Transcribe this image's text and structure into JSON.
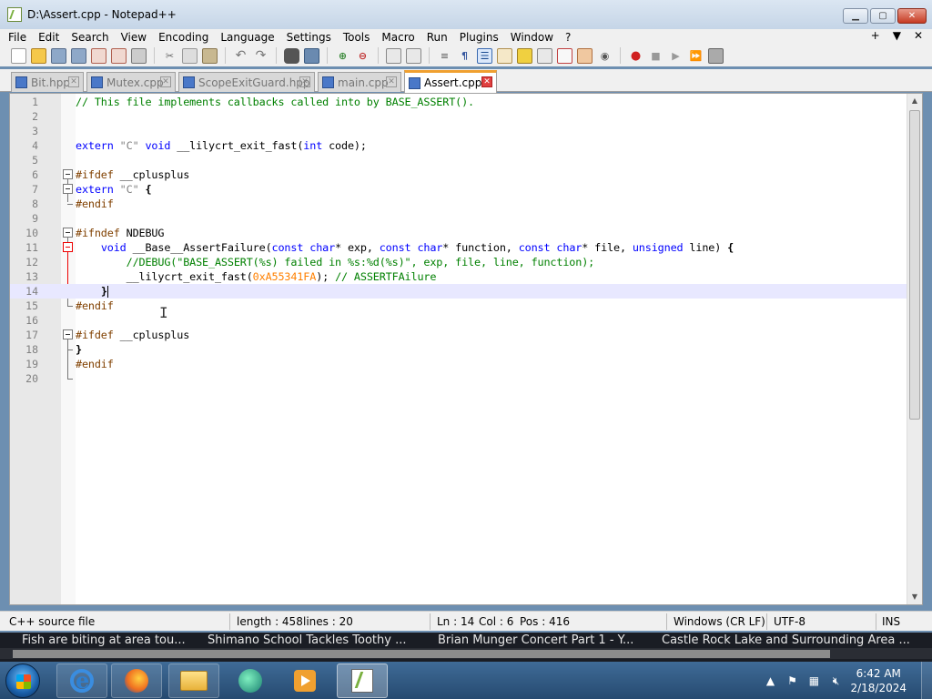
{
  "window": {
    "title": "D:\\Assert.cpp - Notepad++"
  },
  "menu": {
    "items": [
      "File",
      "Edit",
      "Search",
      "View",
      "Encoding",
      "Language",
      "Settings",
      "Tools",
      "Macro",
      "Run",
      "Plugins",
      "Window",
      "?"
    ],
    "right": [
      "+",
      "▼",
      "✕"
    ]
  },
  "tabs": [
    {
      "label": "Bit.hpp"
    },
    {
      "label": "Mutex.cpp"
    },
    {
      "label": "ScopeExitGuard.hpp"
    },
    {
      "label": "main.cpp"
    },
    {
      "label": "Assert.cpp",
      "active": true
    }
  ],
  "editor": {
    "lines": [
      {
        "n": "1",
        "code": "// This file implements callbacks called into by BASE_ASSERT()."
      },
      {
        "n": "2",
        "code": ""
      },
      {
        "n": "3",
        "code": ""
      },
      {
        "n": "4",
        "code": "extern \"C\" void __lilycrt_exit_fast(int code);"
      },
      {
        "n": "5",
        "code": ""
      },
      {
        "n": "6",
        "code": "#ifdef __cplusplus"
      },
      {
        "n": "7",
        "code": "extern \"C\" {"
      },
      {
        "n": "8",
        "code": "#endif"
      },
      {
        "n": "9",
        "code": ""
      },
      {
        "n": "10",
        "code": "#ifndef NDEBUG"
      },
      {
        "n": "11",
        "code": "    void __Base__AssertFailure(const char* exp, const char* function, const char* file, unsigned line) {"
      },
      {
        "n": "12",
        "code": "        //DEBUG(\"BASE_ASSERT(%s) failed in %s:%d(%s)\", exp, file, line, function);"
      },
      {
        "n": "13",
        "code": "        __lilycrt_exit_fast(0xA55341FA); // ASSERTFAilure"
      },
      {
        "n": "14",
        "code": "    }"
      },
      {
        "n": "15",
        "code": "#endif"
      },
      {
        "n": "16",
        "code": ""
      },
      {
        "n": "17",
        "code": "#ifdef __cplusplus"
      },
      {
        "n": "18",
        "code": "}"
      },
      {
        "n": "19",
        "code": "#endif"
      },
      {
        "n": "20",
        "code": ""
      }
    ]
  },
  "status": {
    "file_type": "C++ source file",
    "length": "length : 458",
    "lines": "lines : 20",
    "ln": "Ln : 14",
    "col": "Col : 6",
    "pos": "Pos : 416",
    "eol": "Windows (CR LF)",
    "encoding": "UTF-8",
    "mode": "INS"
  },
  "ticker": {
    "items": [
      "Fish are biting at area tou...",
      "Shimano School Tackles Toothy ...",
      "Brian Munger Concert Part 1 - Y...",
      "Castle Rock Lake and Surrounding Area ..."
    ]
  },
  "taskbar": {
    "time": "6:42 AM",
    "date": "2/18/2024"
  },
  "colors": {
    "comment": "#008000",
    "keyword": "#0000ff",
    "string": "#808080",
    "preprocessor": "#804000",
    "number": "#ff8000",
    "current_line": "#e8e8ff",
    "active_tab_accent": "#f0a030"
  }
}
